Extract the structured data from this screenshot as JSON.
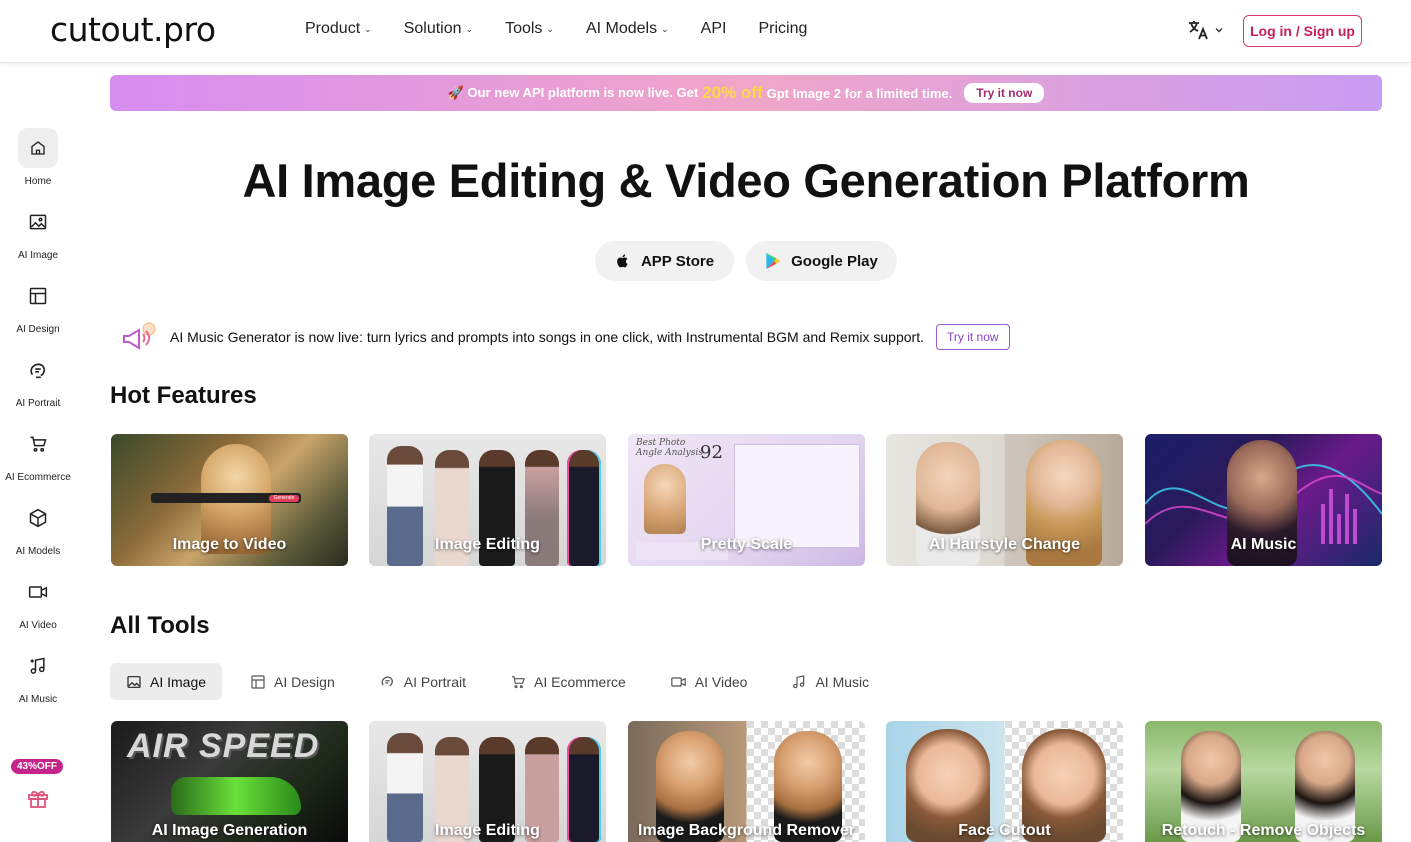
{
  "header": {
    "logo": "cutout.pro",
    "nav": [
      {
        "label": "Product",
        "dropdown": true
      },
      {
        "label": "Solution",
        "dropdown": true
      },
      {
        "label": "Tools",
        "dropdown": true
      },
      {
        "label": "AI Models",
        "dropdown": true
      },
      {
        "label": "API",
        "dropdown": false
      },
      {
        "label": "Pricing",
        "dropdown": false
      }
    ],
    "login_label": "Log in / Sign up"
  },
  "sidebar": {
    "items": [
      {
        "label": "Home",
        "icon": "home-icon"
      },
      {
        "label": "AI Image",
        "icon": "image-icon"
      },
      {
        "label": "AI Design",
        "icon": "layout-icon"
      },
      {
        "label": "AI Portrait",
        "icon": "portrait-icon"
      },
      {
        "label": "AI Ecommerce",
        "icon": "cart-icon"
      },
      {
        "label": "AI Models",
        "icon": "cube-icon"
      },
      {
        "label": "AI Video",
        "icon": "video-icon"
      },
      {
        "label": "AI Music",
        "icon": "music-icon"
      }
    ],
    "promo_badge": "43%OFF"
  },
  "banner": {
    "text_before": "🚀 Our new API platform is now live. Get",
    "highlight": "20% off",
    "text_after": "Gpt Image 2 for a limited time.",
    "button": "Try it now"
  },
  "hero": {
    "title": "AI Image Editing & Video Generation Platform",
    "app_store": "APP Store",
    "google_play": "Google Play"
  },
  "notice": {
    "text": "AI Music Generator is now live: turn lyrics and prompts into songs in one click, with Instrumental BGM and Remix support.",
    "button": "Try it now"
  },
  "hot_features": {
    "title": "Hot Features",
    "cards": [
      {
        "label": "Image to Video"
      },
      {
        "label": "Image Editing"
      },
      {
        "label": "Pretty Scale"
      },
      {
        "label": "AI Hairstyle Change"
      },
      {
        "label": "AI Music"
      }
    ]
  },
  "all_tools": {
    "title": "All Tools",
    "tabs": [
      {
        "label": "AI Image",
        "icon": "image-icon",
        "active": true
      },
      {
        "label": "AI Design",
        "icon": "layout-icon",
        "active": false
      },
      {
        "label": "AI Portrait",
        "icon": "portrait-icon",
        "active": false
      },
      {
        "label": "AI Ecommerce",
        "icon": "cart-icon",
        "active": false
      },
      {
        "label": "AI Video",
        "icon": "video-icon",
        "active": false
      },
      {
        "label": "AI Music",
        "icon": "music-icon",
        "active": false
      }
    ],
    "cards": [
      {
        "label": "AI Image Generation"
      },
      {
        "label": "Image Editing"
      },
      {
        "label": "Image Background Remover"
      },
      {
        "label": "Face Cutout"
      },
      {
        "label": "Retouch - Remove Objects"
      }
    ]
  },
  "thumb_texts": {
    "air_speed": "AIR SPEED",
    "best_photo": "Best Photo",
    "angle_analysis": "Angle Analysis",
    "score": "92",
    "generate": "Generate"
  }
}
